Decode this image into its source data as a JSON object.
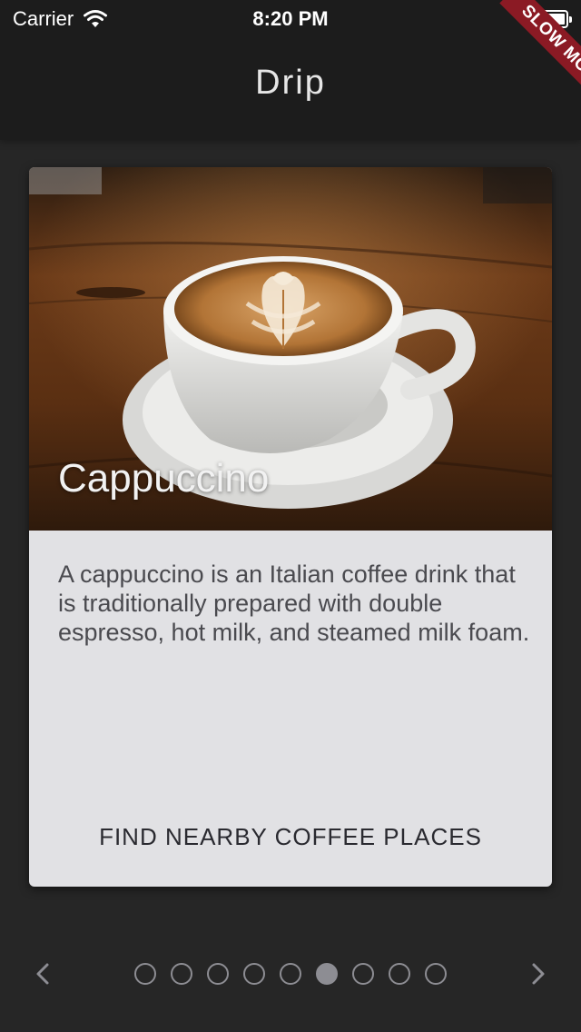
{
  "status_bar": {
    "carrier": "Carrier",
    "time": "8:20 PM",
    "wifi_icon": "wifi-icon",
    "battery_icon": "battery-icon"
  },
  "app_bar": {
    "title": "Drip"
  },
  "debug_banner": {
    "label": "SLOW MODE",
    "color": "#8b1a24"
  },
  "card": {
    "title": "Cappuccino",
    "description": "A cappuccino is an Italian coffee drink that is traditionally prepared with double espresso, hot milk, and steamed milk foam.",
    "action_label": "FIND NEARBY COFFEE PLACES",
    "image": "cappuccino-latte-art-photo"
  },
  "pager": {
    "prev_icon": "chevron-left-icon",
    "next_icon": "chevron-right-icon",
    "page_count": 9,
    "active_index": 5
  },
  "colors": {
    "background": "#262626",
    "app_bar": "#1c1c1c",
    "card": "#e1e1e4",
    "dot": "#8d8d93"
  }
}
